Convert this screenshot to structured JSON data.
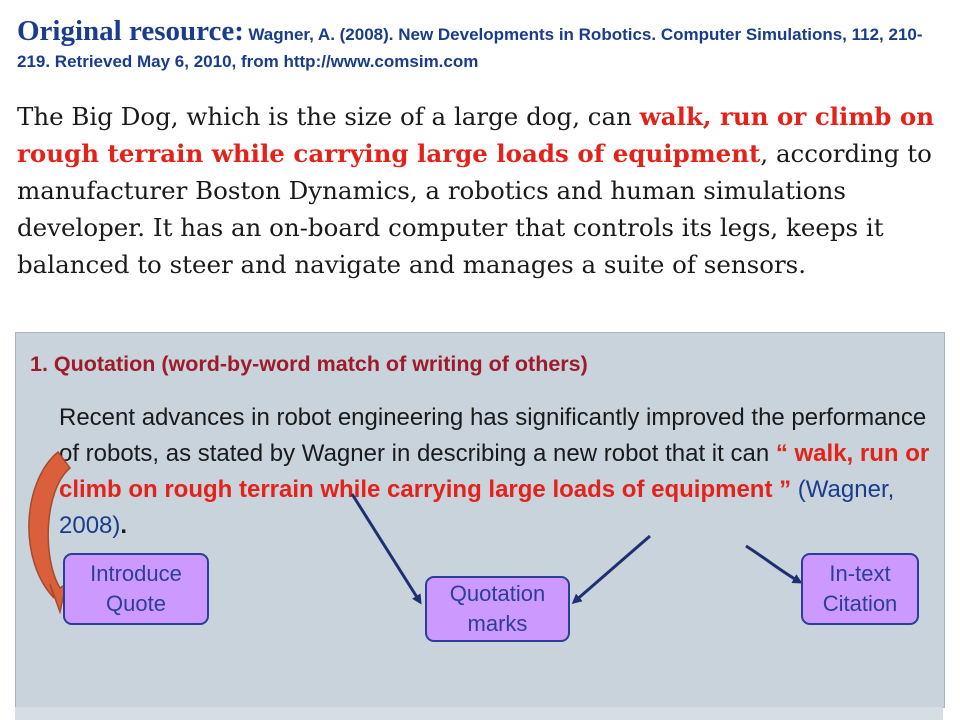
{
  "header": {
    "label": "Original resource:",
    "citation": "Wagner, A. (2008). New Developments in Robotics. Computer Simulations, 112, 210-219. Retrieved May 6, 2010, from http://www.comsim.com"
  },
  "passage": {
    "before": "The Big Dog, which is the size of a large dog, can ",
    "highlight": "walk, run or climb on rough terrain while carrying large loads of equipment",
    "after": ", according to manufacturer Boston Dynamics, a robotics and human simulations developer.  It has an on-board computer that controls its legs, keeps it balanced to steer and navigate and manages a suite of sensors."
  },
  "example": {
    "title": "1. Quotation (word-by-word match of writing of others)",
    "text_before": "Recent advances in robot engineering has significantly improved the performance of robots, as stated by Wagner in describing a new robot that it can ",
    "open_quote": "“",
    "quote": " walk, run or climb on rough terrain while carrying large loads of equipment ",
    "close_quote": "”",
    "citation": " (Wagner, 2008)",
    "period": "."
  },
  "labels": {
    "introduce": "Introduce Quote",
    "quotation": "Quotation marks",
    "intext": "In-text Citation"
  },
  "colors": {
    "title_blue": "#1a3c8c",
    "highlight_red": "#e3221a",
    "heading_maroon": "#9d1b2a",
    "label_fill": "#cc99ff",
    "arrow_orange": "#d9603b",
    "arrow_navy": "#1f3070",
    "panel": "#c8d3dc"
  }
}
